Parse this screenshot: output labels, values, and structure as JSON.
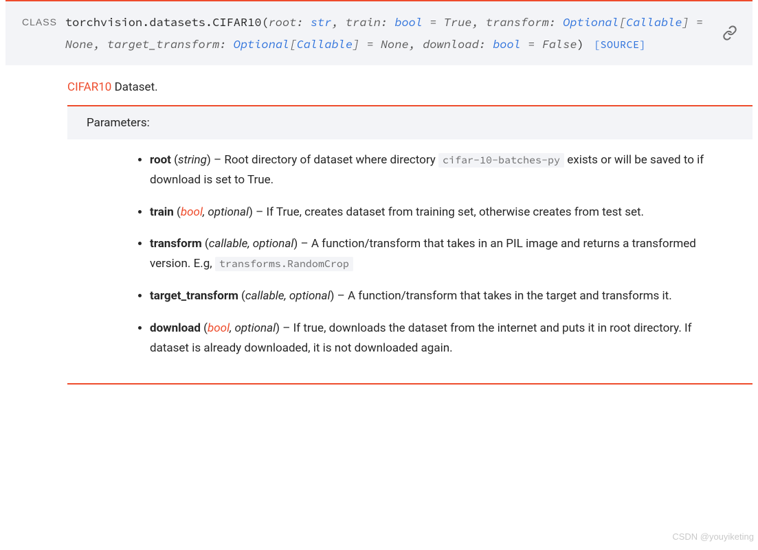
{
  "signature": {
    "class_label": "CLASS",
    "qualname": "torchvision.datasets.CIFAR10",
    "params": [
      {
        "name": "root",
        "type": "str"
      },
      {
        "name": "train",
        "type": "bool",
        "default": "True"
      },
      {
        "name": "transform",
        "type_prefix": "Optional",
        "type_inner": "Callable",
        "default": "None"
      },
      {
        "name": "target_transform",
        "type_prefix": "Optional",
        "type_inner": "Callable",
        "default": "None"
      },
      {
        "name": "download",
        "type": "bool",
        "default": "False"
      }
    ],
    "source_label": "[SOURCE]"
  },
  "description": {
    "link_text": "CIFAR10",
    "rest": " Dataset."
  },
  "params_header": "Parameters:",
  "parameters": [
    {
      "name": "root",
      "type_html": "string",
      "desc_pre": "Root directory of dataset where directory ",
      "code": "cifar-10-batches-py",
      "desc_post": " exists or will be saved to if download is set to True."
    },
    {
      "name": "train",
      "type_link": "bool",
      "type_suffix": ", optional",
      "desc": "If True, creates dataset from training set, otherwise creates from test set."
    },
    {
      "name": "transform",
      "type_html": "callable, optional",
      "desc_pre": "A function/transform that takes in an PIL image and returns a transformed version. E.g, ",
      "code": "transforms.RandomCrop"
    },
    {
      "name": "target_transform",
      "type_html": "callable, optional",
      "desc": "A function/transform that takes in the target and transforms it."
    },
    {
      "name": "download",
      "type_link": "bool",
      "type_suffix": ", optional",
      "desc": "If true, downloads the dataset from the internet and puts it in root directory. If dataset is already downloaded, it is not downloaded again."
    }
  ],
  "watermark": "CSDN @youyiketing"
}
